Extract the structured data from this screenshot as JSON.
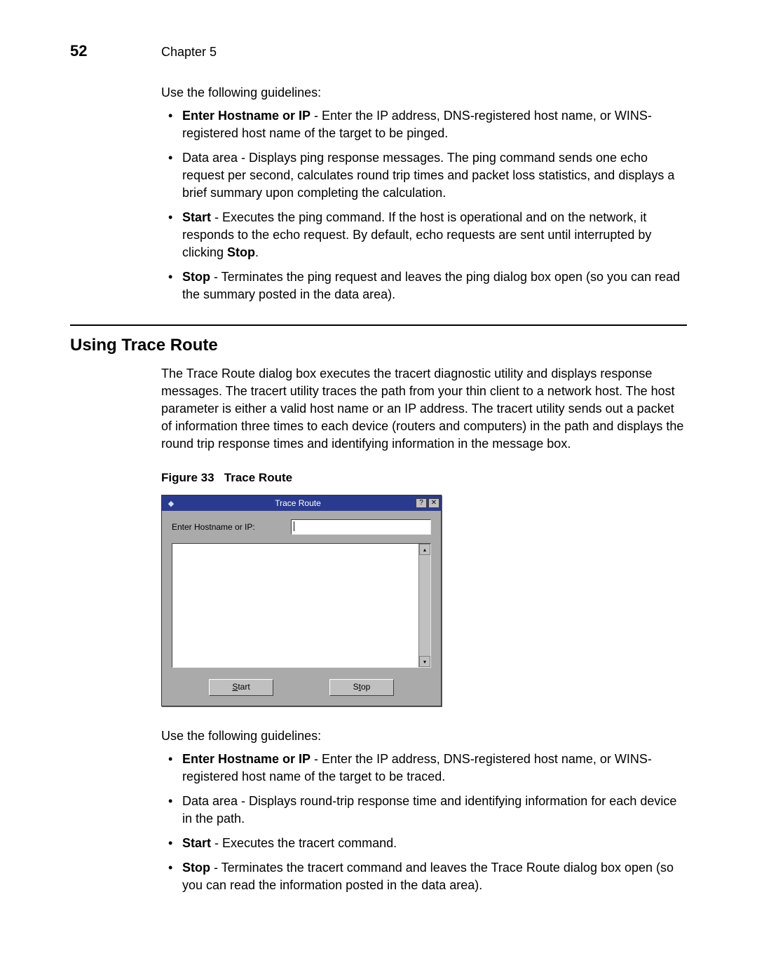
{
  "header": {
    "page_number": "52",
    "chapter": "Chapter 5"
  },
  "intro1": "Use the following guidelines:",
  "bullets1": [
    {
      "lead": "Enter Hostname or IP",
      "rest": " - Enter the IP address, DNS-registered host name, or WINS-registered host name of the target to be pinged."
    },
    {
      "lead": "",
      "rest": "Data area - Displays ping response messages. The ping command sends one echo request per second, calculates round trip times and packet loss statistics, and displays a brief summary upon completing the calculation."
    },
    {
      "lead": "Start",
      "rest": " - Executes the ping command. If the host is operational and on the network, it responds to the echo request. By default, echo requests are sent until interrupted by clicking ",
      "tail_bold": "Stop",
      "tail_rest": "."
    },
    {
      "lead": "Stop",
      "rest": " - Terminates the ping request and leaves the ping dialog box open (so you can read the summary posted in the data area)."
    }
  ],
  "section2": {
    "heading": "Using Trace Route",
    "para": "The Trace Route dialog box executes the tracert diagnostic utility and displays response messages. The tracert utility traces the path from your thin client to a network host. The host parameter is either a valid host name or an IP address. The tracert utility sends out a packet of information three times to each device (routers and computers) in the path and displays the round trip response times and identifying information in the message box."
  },
  "figure": {
    "caption_leader": "Figure 33",
    "caption_title": "Trace Route",
    "dialog": {
      "title": "Trace Route",
      "field_label": "Enter Hostname or IP:",
      "start_label": "Start",
      "stop_label": "Stop",
      "close_glyph": "✕",
      "help_glyph": "?",
      "up_glyph": "▴",
      "down_glyph": "▾"
    }
  },
  "intro2": "Use the following guidelines:",
  "bullets2": [
    {
      "lead": "Enter Hostname or IP",
      "rest": " - Enter the IP address, DNS-registered host name, or WINS-registered host name of the target to be traced."
    },
    {
      "lead": "",
      "rest": "Data area - Displays round-trip response time and identifying information for each device in the path."
    },
    {
      "lead": "Start",
      "rest": " - Executes the tracert command."
    },
    {
      "lead": "Stop",
      "rest": " - Terminates the tracert command and leaves the Trace Route dialog box open (so you can read the information posted in the data area)."
    }
  ]
}
